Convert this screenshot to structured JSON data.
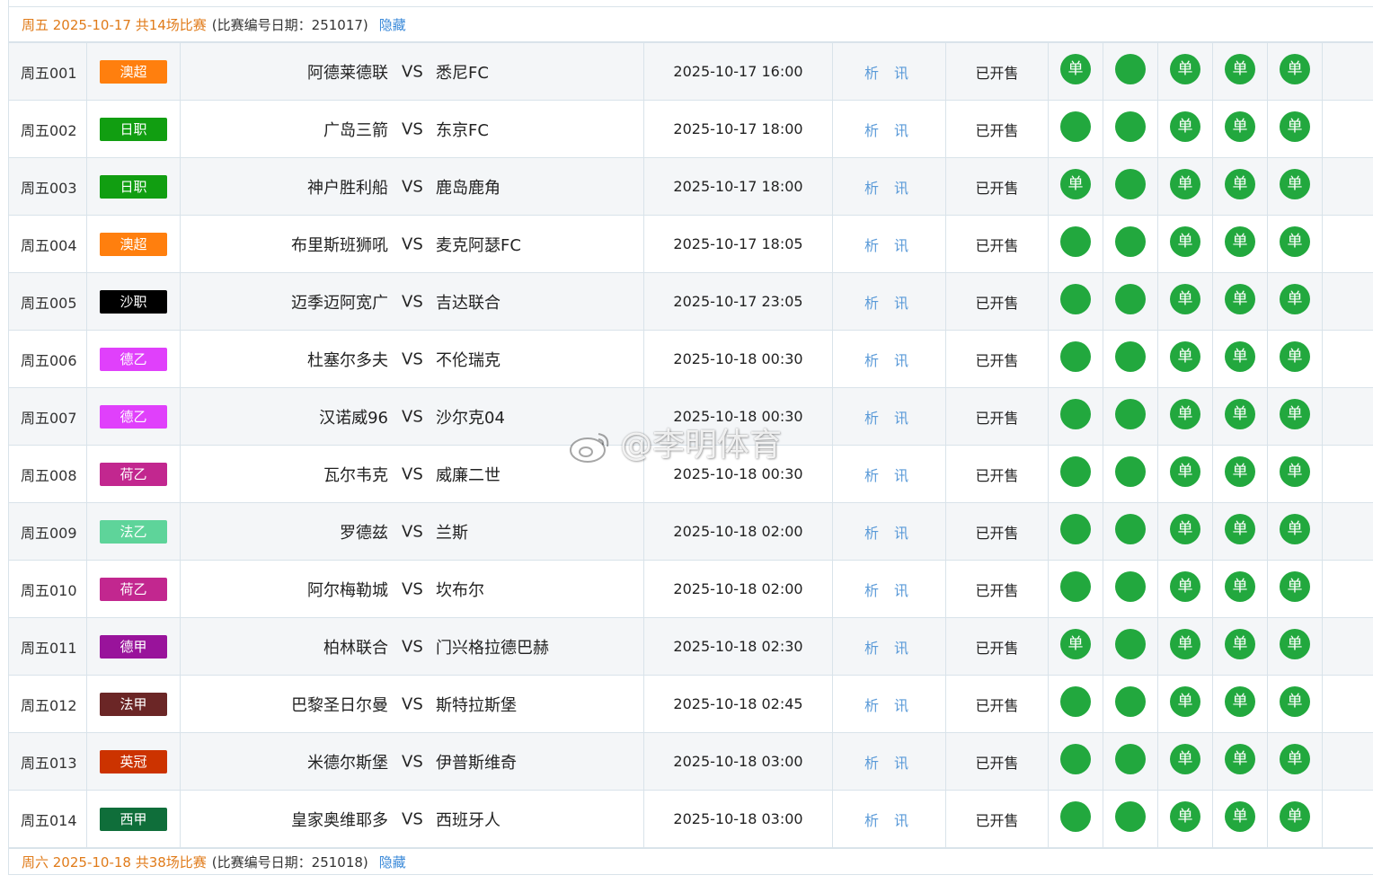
{
  "day1": {
    "date_text": "周五 2025-10-17 共14场比赛",
    "extra_text": "(比赛编号日期：251017)",
    "hide_label": "隐藏"
  },
  "day2": {
    "date_text": "周六 2025-10-18 共38场比赛",
    "extra_text": "(比赛编号日期：251018)",
    "hide_label": "隐藏"
  },
  "info_label": "析 讯",
  "status_label": "已开售",
  "vs_label": "VS",
  "single_label": "单",
  "watermark": "@李明体育",
  "matches": [
    {
      "num": "周五001",
      "league": "澳超",
      "color": "#ff7f0e",
      "home": "阿德莱德联",
      "away": "悉尼FC",
      "time": "2025-10-17 16:00",
      "singles": [
        true,
        false,
        true,
        true,
        true
      ]
    },
    {
      "num": "周五002",
      "league": "日职",
      "color": "#119e11",
      "home": "广岛三箭",
      "away": "东京FC",
      "time": "2025-10-17 18:00",
      "singles": [
        false,
        false,
        true,
        true,
        true
      ]
    },
    {
      "num": "周五003",
      "league": "日职",
      "color": "#119e11",
      "home": "神户胜利船",
      "away": "鹿岛鹿角",
      "time": "2025-10-17 18:00",
      "singles": [
        true,
        false,
        true,
        true,
        true
      ]
    },
    {
      "num": "周五004",
      "league": "澳超",
      "color": "#ff7f0e",
      "home": "布里斯班狮吼",
      "away": "麦克阿瑟FC",
      "time": "2025-10-17 18:05",
      "singles": [
        false,
        false,
        true,
        true,
        true
      ]
    },
    {
      "num": "周五005",
      "league": "沙职",
      "color": "#000000",
      "home": "迈季迈阿宽广",
      "away": "吉达联合",
      "time": "2025-10-17 23:05",
      "singles": [
        false,
        false,
        true,
        true,
        true
      ]
    },
    {
      "num": "周五006",
      "league": "德乙",
      "color": "#e040fb",
      "home": "杜塞尔多夫",
      "away": "不伦瑞克",
      "time": "2025-10-18 00:30",
      "singles": [
        false,
        false,
        true,
        true,
        true
      ]
    },
    {
      "num": "周五007",
      "league": "德乙",
      "color": "#e040fb",
      "home": "汉诺威96",
      "away": "沙尔克04",
      "time": "2025-10-18 00:30",
      "singles": [
        false,
        false,
        true,
        true,
        true
      ]
    },
    {
      "num": "周五008",
      "league": "荷乙",
      "color": "#c2278f",
      "home": "瓦尔韦克",
      "away": "威廉二世",
      "time": "2025-10-18 00:30",
      "singles": [
        false,
        false,
        true,
        true,
        true
      ]
    },
    {
      "num": "周五009",
      "league": "法乙",
      "color": "#5ed49a",
      "home": "罗德兹",
      "away": "兰斯",
      "time": "2025-10-18 02:00",
      "singles": [
        false,
        false,
        true,
        true,
        true
      ]
    },
    {
      "num": "周五010",
      "league": "荷乙",
      "color": "#c2278f",
      "home": "阿尔梅勒城",
      "away": "坎布尔",
      "time": "2025-10-18 02:00",
      "singles": [
        false,
        false,
        true,
        true,
        true
      ]
    },
    {
      "num": "周五011",
      "league": "德甲",
      "color": "#99139b",
      "home": "柏林联合",
      "away": "门兴格拉德巴赫",
      "time": "2025-10-18 02:30",
      "singles": [
        true,
        false,
        true,
        true,
        true
      ]
    },
    {
      "num": "周五012",
      "league": "法甲",
      "color": "#6b2626",
      "home": "巴黎圣日尔曼",
      "away": "斯特拉斯堡",
      "time": "2025-10-18 02:45",
      "singles": [
        false,
        false,
        true,
        true,
        true
      ]
    },
    {
      "num": "周五013",
      "league": "英冠",
      "color": "#cc3300",
      "home": "米德尔斯堡",
      "away": "伊普斯维奇",
      "time": "2025-10-18 03:00",
      "singles": [
        false,
        false,
        true,
        true,
        true
      ]
    },
    {
      "num": "周五014",
      "league": "西甲",
      "color": "#0f6e3a",
      "home": "皇家奥维耶多",
      "away": "西班牙人",
      "time": "2025-10-18 03:00",
      "singles": [
        false,
        false,
        true,
        true,
        true
      ]
    }
  ]
}
